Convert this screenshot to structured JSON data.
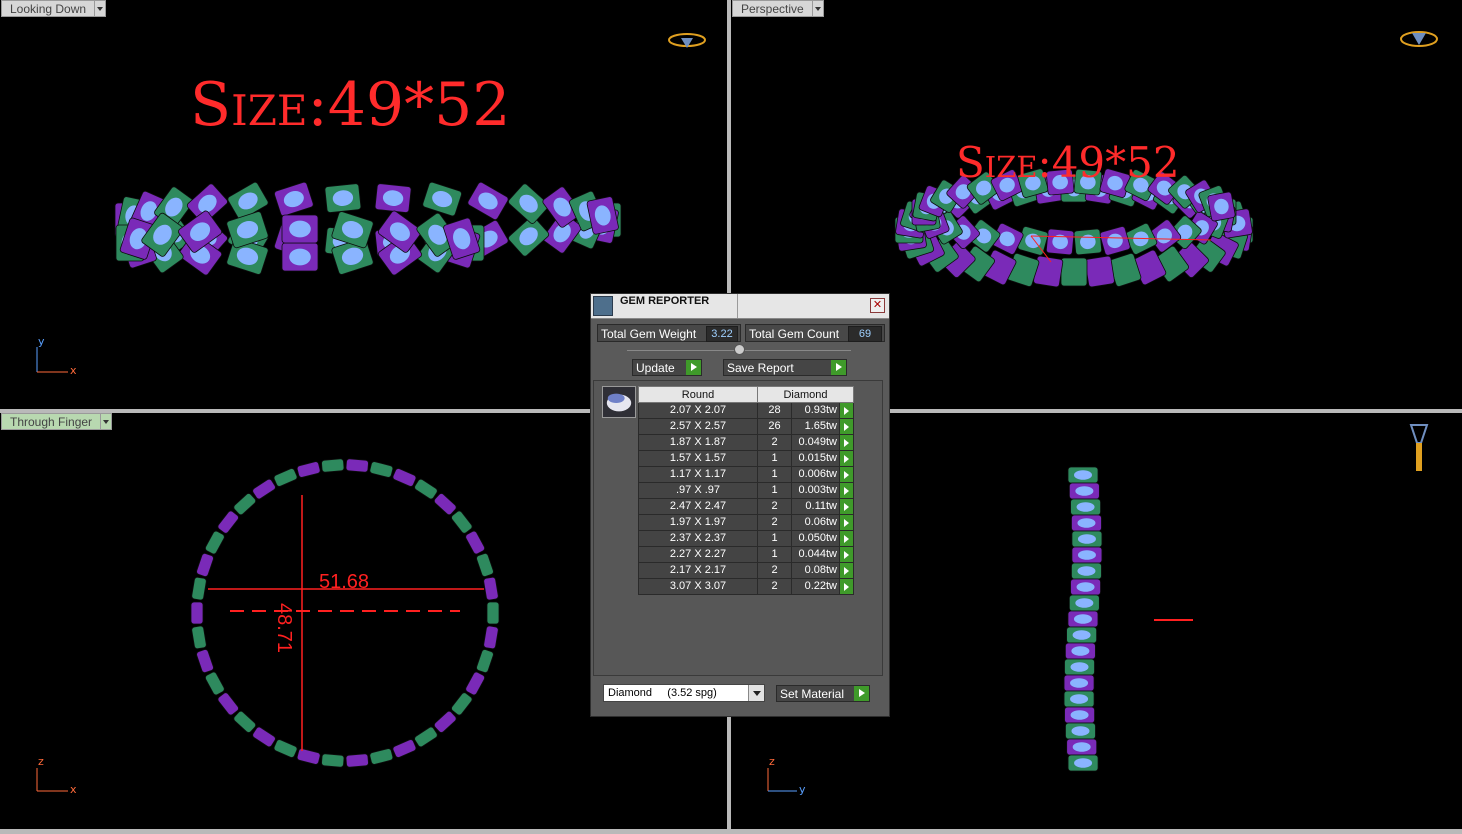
{
  "viewports": {
    "top_left": {
      "label": "Looking Down",
      "size_text": "Size:49*52",
      "axis": [
        "y",
        "x"
      ]
    },
    "top_right": {
      "label": "Perspective",
      "size_text": "Size:49*52"
    },
    "bottom_left": {
      "label": "Through Finger",
      "dim_horizontal": "51.68",
      "dim_vertical": "48.71",
      "axis": [
        "z",
        "x"
      ]
    },
    "bottom_right": {
      "axis": [
        "z",
        "y"
      ]
    }
  },
  "gem_reporter": {
    "title": "GEM REPORTER",
    "total_weight_label": "Total Gem Weight",
    "total_weight_value": "3.22",
    "total_count_label": "Total Gem Count",
    "total_count_value": "69",
    "update_label": "Update",
    "save_report_label": "Save Report",
    "columns": [
      "Round",
      "Diamond"
    ],
    "rows": [
      {
        "size": "2.07 X 2.07",
        "count": "28",
        "weight": "0.93tw"
      },
      {
        "size": "2.57 X 2.57",
        "count": "26",
        "weight": "1.65tw"
      },
      {
        "size": "1.87 X 1.87",
        "count": "2",
        "weight": "0.049tw"
      },
      {
        "size": "1.57 X 1.57",
        "count": "1",
        "weight": "0.015tw"
      },
      {
        "size": "1.17 X 1.17",
        "count": "1",
        "weight": "0.006tw"
      },
      {
        "size": ".97 X .97",
        "count": "1",
        "weight": "0.003tw"
      },
      {
        "size": "2.47 X 2.47",
        "count": "2",
        "weight": "0.11tw"
      },
      {
        "size": "1.97 X 1.97",
        "count": "2",
        "weight": "0.06tw"
      },
      {
        "size": "2.37 X 2.37",
        "count": "1",
        "weight": "0.050tw"
      },
      {
        "size": "2.27 X 2.27",
        "count": "1",
        "weight": "0.044tw"
      },
      {
        "size": "2.17 X 2.17",
        "count": "2",
        "weight": "0.08tw"
      },
      {
        "size": "3.07 X 3.07",
        "count": "2",
        "weight": "0.22tw"
      }
    ],
    "material_value": "Diamond     (3.52 spg)",
    "set_material_label": "Set Material"
  },
  "colors": {
    "gem_green": "#2e8a5e",
    "gem_purple": "#7a2ab8",
    "gem_stone": "#8ab4ff",
    "annotation_red": "#ff2b2b"
  }
}
